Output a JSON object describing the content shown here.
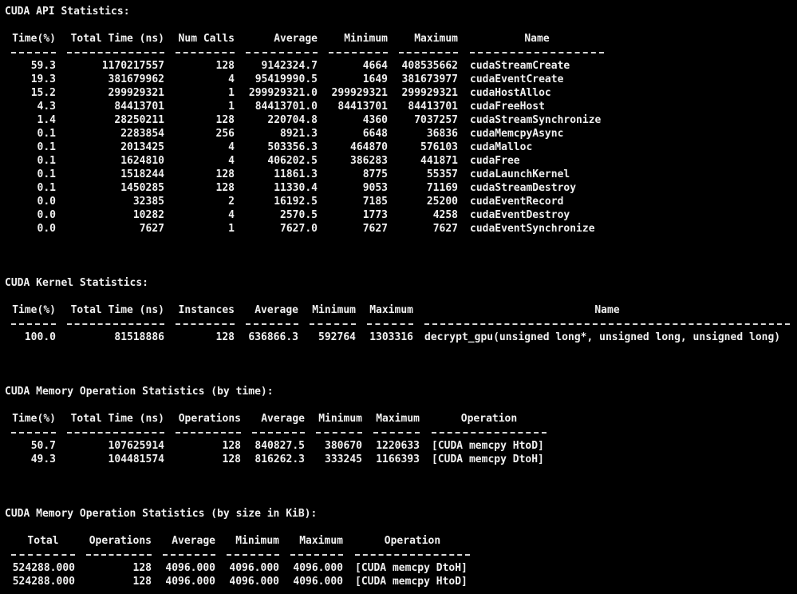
{
  "api": {
    "title": "CUDA API Statistics:",
    "headers": [
      "Time(%)",
      "Total Time (ns)",
      "Num Calls",
      "Average",
      "Minimum",
      "Maximum",
      "Name"
    ],
    "rows": [
      [
        "59.3",
        "1170217557",
        "128",
        "9142324.7",
        "4664",
        "408535662",
        "cudaStreamCreate"
      ],
      [
        "19.3",
        "381679962",
        "4",
        "95419990.5",
        "1649",
        "381673977",
        "cudaEventCreate"
      ],
      [
        "15.2",
        "299929321",
        "1",
        "299929321.0",
        "299929321",
        "299929321",
        "cudaHostAlloc"
      ],
      [
        "4.3",
        "84413701",
        "1",
        "84413701.0",
        "84413701",
        "84413701",
        "cudaFreeHost"
      ],
      [
        "1.4",
        "28250211",
        "128",
        "220704.8",
        "4360",
        "7037257",
        "cudaStreamSynchronize"
      ],
      [
        "0.1",
        "2283854",
        "256",
        "8921.3",
        "6648",
        "36836",
        "cudaMemcpyAsync"
      ],
      [
        "0.1",
        "2013425",
        "4",
        "503356.3",
        "464870",
        "576103",
        "cudaMalloc"
      ],
      [
        "0.1",
        "1624810",
        "4",
        "406202.5",
        "386283",
        "441871",
        "cudaFree"
      ],
      [
        "0.1",
        "1518244",
        "128",
        "11861.3",
        "8775",
        "55357",
        "cudaLaunchKernel"
      ],
      [
        "0.1",
        "1450285",
        "128",
        "11330.4",
        "9053",
        "71169",
        "cudaStreamDestroy"
      ],
      [
        "0.0",
        "32385",
        "2",
        "16192.5",
        "7185",
        "25200",
        "cudaEventRecord"
      ],
      [
        "0.0",
        "10282",
        "4",
        "2570.5",
        "1773",
        "4258",
        "cudaEventDestroy"
      ],
      [
        "0.0",
        "7627",
        "1",
        "7627.0",
        "7627",
        "7627",
        "cudaEventSynchronize"
      ]
    ]
  },
  "kernel": {
    "title": "CUDA Kernel Statistics:",
    "headers": [
      "Time(%)",
      "Total Time (ns)",
      "Instances",
      "Average",
      "Minimum",
      "Maximum",
      "Name"
    ],
    "rows": [
      [
        "100.0",
        "81518886",
        "128",
        "636866.3",
        "592764",
        "1303316",
        "decrypt_gpu(unsigned long*, unsigned long, unsigned long)"
      ]
    ]
  },
  "memtime": {
    "title": "CUDA Memory Operation Statistics (by time):",
    "headers": [
      "Time(%)",
      "Total Time (ns)",
      "Operations",
      "Average",
      "Minimum",
      "Maximum",
      "Operation"
    ],
    "rows": [
      [
        "50.7",
        "107625914",
        "128",
        "840827.5",
        "380670",
        "1220633",
        "[CUDA memcpy HtoD]"
      ],
      [
        "49.3",
        "104481574",
        "128",
        "816262.3",
        "333245",
        "1166393",
        "[CUDA memcpy DtoH]"
      ]
    ]
  },
  "memsize": {
    "title": "CUDA Memory Operation Statistics (by size in KiB):",
    "headers": [
      "Total",
      "Operations",
      "Average",
      "Minimum",
      "Maximum",
      "Operation"
    ],
    "rows": [
      [
        "524288.000",
        "128",
        "4096.000",
        "4096.000",
        "4096.000",
        "[CUDA memcpy DtoH]"
      ],
      [
        "524288.000",
        "128",
        "4096.000",
        "4096.000",
        "4096.000",
        "[CUDA memcpy HtoD]"
      ]
    ]
  },
  "colors": {
    "background": "#000000",
    "text": "#f0f0f0"
  }
}
